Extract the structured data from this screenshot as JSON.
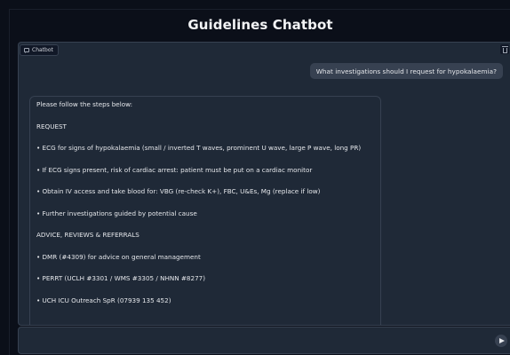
{
  "app": {
    "title": "Guidelines Chatbot"
  },
  "chatbot": {
    "label": "Chatbot",
    "label_icon": "chat-bubble-icon",
    "clear_icon": "trash-icon"
  },
  "messages": {
    "user": "What investigations should I request for hypokalaemia?",
    "bot_lines": [
      "Please follow the steps below:",
      "REQUEST",
      "• ECG for signs of hypokalaemia (small / inverted T waves, prominent U wave, large P wave, long PR)",
      "• If ECG signs present, risk of cardiac arrest: patient must be put on a cardiac monitor",
      "• Obtain IV access and take blood for: VBG (re-check K+), FBC, U&Es, Mg (replace if low)",
      "• Further investigations guided by potential cause",
      "ADVICE, REVIEWS & REFERRALS",
      "• DMR (#4309) for advice on general management",
      "• PERRT (UCLH #3301 / WMS #3305 / NHNN #8277)",
      "• UCH ICU Outreach SpR (07939 135 452)"
    ]
  },
  "input": {
    "value": "",
    "placeholder": "",
    "send_icon": "send-icon"
  },
  "colors": {
    "background": "#0b0f19",
    "panel": "#1f2937",
    "border": "#374151",
    "user_bubble": "#374151",
    "text": "#e5e7eb"
  }
}
